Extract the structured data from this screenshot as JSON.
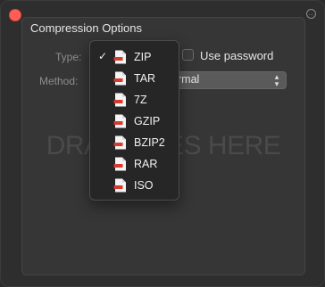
{
  "panel": {
    "title": "Compression Options",
    "type_label": "Type:",
    "method_label": "Method:",
    "use_password_label": "Use password",
    "use_password_checked": false,
    "method_value": "rmal"
  },
  "drop_zone": {
    "text": "DRAG FILES HERE"
  },
  "type_menu": {
    "selected": "ZIP",
    "items": [
      {
        "label": "ZIP",
        "checked": true
      },
      {
        "label": "TAR",
        "checked": false
      },
      {
        "label": "7Z",
        "checked": false
      },
      {
        "label": "GZIP",
        "checked": false
      },
      {
        "label": "BZIP2",
        "checked": false
      },
      {
        "label": "RAR",
        "checked": false
      },
      {
        "label": "ISO",
        "checked": false
      }
    ]
  },
  "colors": {
    "close": "#ff5f57",
    "file_icon_red": "#d93a2f",
    "file_icon_body": "#f4f4f4"
  },
  "icons": {
    "checkmark": "✓",
    "more": "…",
    "chevron_up": "▴",
    "chevron_down": "▾"
  }
}
